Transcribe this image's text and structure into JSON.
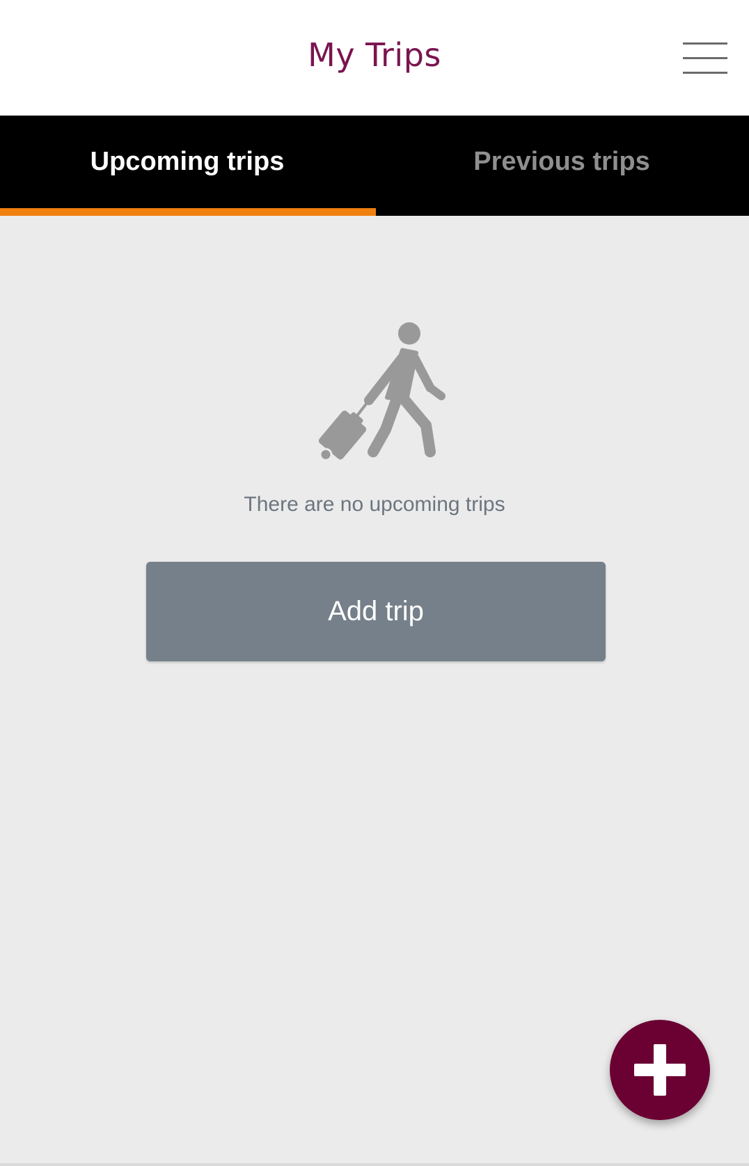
{
  "header": {
    "title": "My Trips",
    "menu_icon": "hamburger-menu-icon"
  },
  "tabs": [
    {
      "label": "Upcoming trips",
      "active": true
    },
    {
      "label": "Previous trips",
      "active": false
    }
  ],
  "empty_state": {
    "icon": "traveler-with-luggage-icon",
    "message": "There are no upcoming trips",
    "button_label": "Add trip"
  },
  "fab": {
    "icon": "plus-icon"
  },
  "colors": {
    "title": "#7a1450",
    "tab_indicator": "#f08010",
    "fab": "#6b0032",
    "button": "#76808a"
  }
}
